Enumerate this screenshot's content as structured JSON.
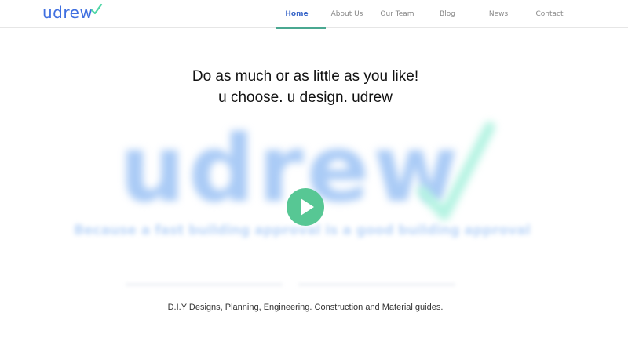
{
  "logo": {
    "text": "udrew",
    "icon": "checkmark-icon",
    "text_color": "#3f6fe0",
    "check_color": "#4fd6a6"
  },
  "nav": {
    "items": [
      {
        "label": "Home",
        "active": true
      },
      {
        "label": "About Us"
      },
      {
        "label": "Our Team"
      },
      {
        "label": "Blog"
      },
      {
        "label": "News"
      },
      {
        "label": "Contact"
      }
    ],
    "active_color": "#3a67c9",
    "underline_color": "#4aa891"
  },
  "headline": {
    "line1": "Do as much or as little as you like!",
    "line2": "u choose. u design. udrew"
  },
  "hero": {
    "word": "udrew",
    "tagline": "Because a fast building approval is a good building approval"
  },
  "play_button": {
    "icon": "play-icon",
    "color": "#57c794"
  },
  "subtitle": "D.I.Y Designs, Planning, Engineering. Construction and Material guides."
}
